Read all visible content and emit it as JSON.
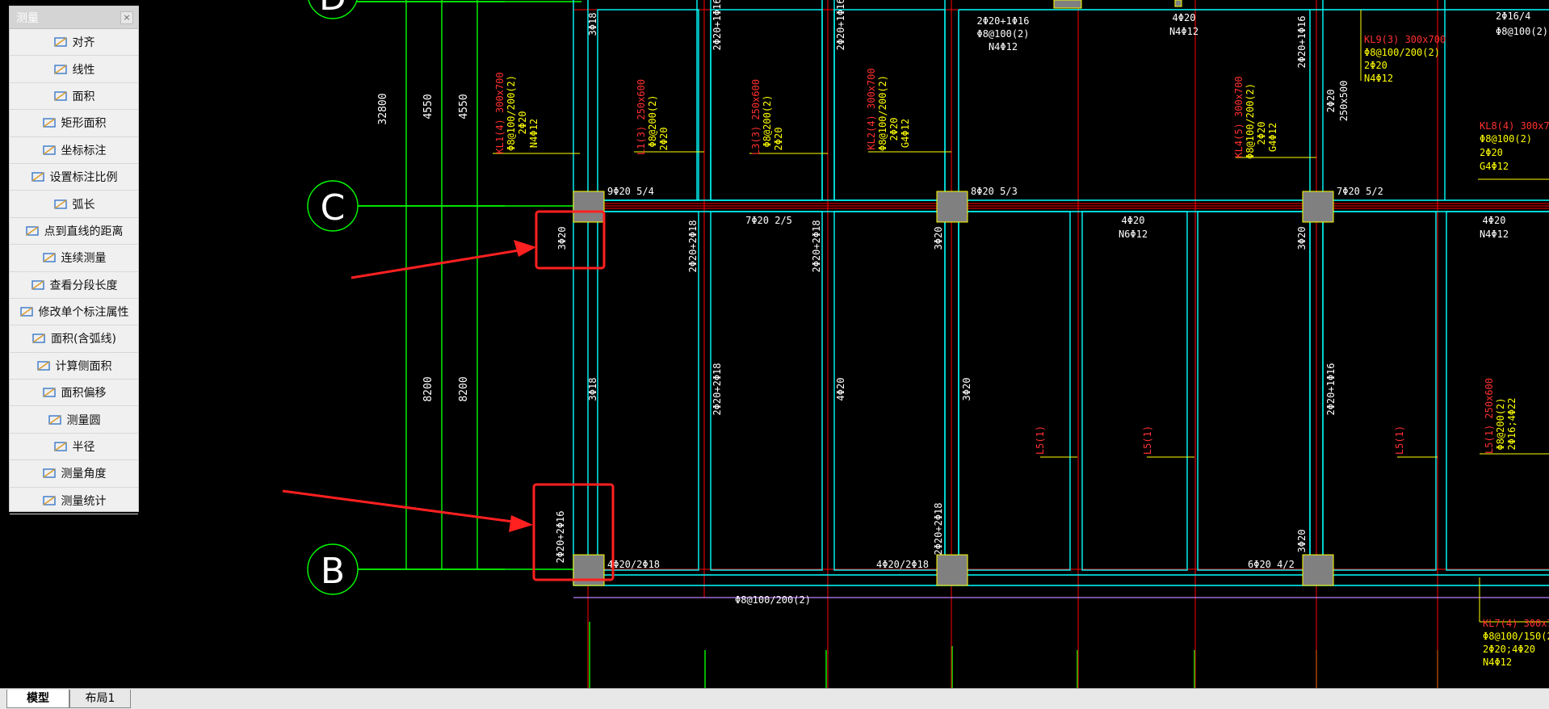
{
  "panel": {
    "title": "测量",
    "close": "×",
    "items": [
      {
        "label": "对齐",
        "icon": "align-measure-icon"
      },
      {
        "label": "线性",
        "icon": "linear-measure-icon"
      },
      {
        "label": "面积",
        "icon": "area-icon"
      },
      {
        "label": "矩形面积",
        "icon": "rect-area-icon"
      },
      {
        "label": "坐标标注",
        "icon": "coordinate-icon"
      },
      {
        "label": "设置标注比例",
        "icon": "scale-icon"
      },
      {
        "label": "弧长",
        "icon": "arc-length-icon"
      },
      {
        "label": "点到直线的距离",
        "icon": "point-line-icon"
      },
      {
        "label": "连续测量",
        "icon": "continuous-measure-icon"
      },
      {
        "label": "查看分段长度",
        "icon": "segment-length-icon"
      },
      {
        "label": "修改单个标注属性",
        "icon": "edit-annotation-icon"
      },
      {
        "label": "面积(含弧线)",
        "icon": "arc-area-icon"
      },
      {
        "label": "计算侧面积",
        "icon": "side-area-icon"
      },
      {
        "label": "面积偏移",
        "icon": "area-offset-icon"
      },
      {
        "label": "测量圆",
        "icon": "circle-measure-icon"
      },
      {
        "label": "半径",
        "icon": "radius-icon"
      },
      {
        "label": "测量角度",
        "icon": "angle-icon"
      },
      {
        "label": "测量统计",
        "icon": "statistics-icon"
      }
    ]
  },
  "tabs": {
    "model": "模型",
    "layout1": "布局1"
  },
  "drawing": {
    "axes": {
      "d": "D",
      "c": "C",
      "b": "B"
    },
    "dims": {
      "total": "32800",
      "a1": "4550",
      "a2": "4550",
      "b1": "8200",
      "b2": "8200"
    },
    "labels": {
      "l1": "3Φ18",
      "l2": "2Φ20+1Φ16",
      "l3": "2Φ20+1Φ16",
      "l4": "2Φ20+1Φ16",
      "l5": "Φ8@100(2)",
      "l6": "N4Φ12",
      "l7": "4Φ20",
      "l8": "N4Φ12",
      "l9": "2Φ20+1Φ16",
      "l10": "KL9(3) 300x700",
      "l11": "Φ8@100/200(2)",
      "l12": "2Φ20",
      "l13": "N4Φ12",
      "l14": "2Φ16/4",
      "l15": "Φ8@100(2)",
      "l16": "2Φ20",
      "l17": "250x500",
      "l18": "KL1(4) 300x700",
      "l19": "Φ8@100/200(2)",
      "l20": "2Φ20",
      "l21": "N4Φ12",
      "l22": "L1(3) 250x600",
      "l23": "Φ8@200(2)",
      "l24": "2Φ20",
      "l25": "L3(3) 250x600",
      "l26": "Φ8@200(2)",
      "l27": "2Φ20",
      "l28": "KL2(4) 300x700",
      "l29": "Φ8@100/200(2)",
      "l30": "2Φ20",
      "l31": "G4Φ12",
      "l32": "KL4(5) 300x700",
      "l33": "Φ8@100/200(2)",
      "l34": "2Φ20",
      "l35": "G4Φ12",
      "l36": "KL8(4) 300x7",
      "l37": "Φ8@100(2)",
      "l38": "2Φ20",
      "l39": "G4Φ12",
      "l40": "9Φ20 5/4",
      "l41": "8Φ20 5/3",
      "l42": "7Φ20 5/2",
      "l43": "3Φ20",
      "l44": "7Φ20 2/5",
      "l45": "2Φ20+2Φ18",
      "l46": "2Φ20+2Φ18",
      "l47": "3Φ20",
      "l48": "4Φ20",
      "l49": "N6Φ12",
      "l50": "3Φ20",
      "l51": "4Φ20",
      "l52": "N4Φ12",
      "l53": "3Φ18",
      "l54": "2Φ20+2Φ18",
      "l55": "4Φ20",
      "l56": "3Φ20",
      "l57": "2Φ20+1Φ16",
      "l58": "L5(1)",
      "l59": "L5(1)",
      "l60": "L5(1)",
      "l61": "L5(1) 250x600",
      "l62": "Φ8@200(2)",
      "l63": "2Φ16;4Φ22",
      "l64": "2Φ20+2Φ16",
      "l65": "4Φ20/2Φ18",
      "l66": "2Φ20+2Φ18",
      "l67": "4Φ20/2Φ18",
      "l68": "3Φ20",
      "l69": "6Φ20 4/2",
      "l70": "Φ8@100/200(2)",
      "l71": "KL7(4) 300x7",
      "l72": "Φ8@100/150(2",
      "l73": "2Φ20;4Φ20",
      "l74": "N4Φ12"
    }
  },
  "colors": {
    "green": "#00ff00",
    "cyan": "#00ffff",
    "yellow": "#ffff00",
    "red": "#ff0000",
    "white": "#ffffff",
    "highlight": "#ff2020"
  }
}
